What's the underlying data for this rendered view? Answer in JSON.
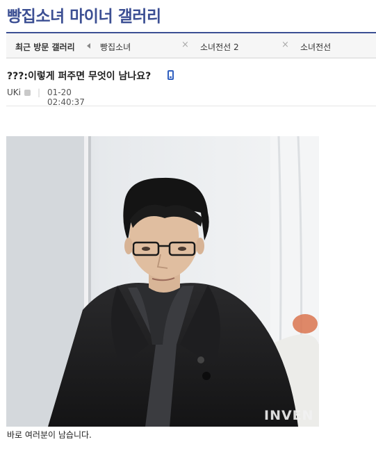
{
  "gallery": {
    "title": "빵집소녀 마이너 갤러리"
  },
  "recent": {
    "label": "최근 방문 갤러리",
    "items": [
      {
        "label": "빵집소녀",
        "close": "×"
      },
      {
        "label": "소녀전선 2",
        "close": "×"
      },
      {
        "label": "소녀전선"
      }
    ]
  },
  "post": {
    "title": "???:이렇게 퍼주면 무엇이 남나요?",
    "author": "UKi",
    "separator": "|",
    "timestamp": "01-20 02:40:37",
    "image": {
      "watermark": "INVEN"
    },
    "body": "바로 여러분이 남습니다."
  },
  "colors": {
    "accent": "#3c4f93",
    "mobile_icon": "#2f5fbf"
  }
}
